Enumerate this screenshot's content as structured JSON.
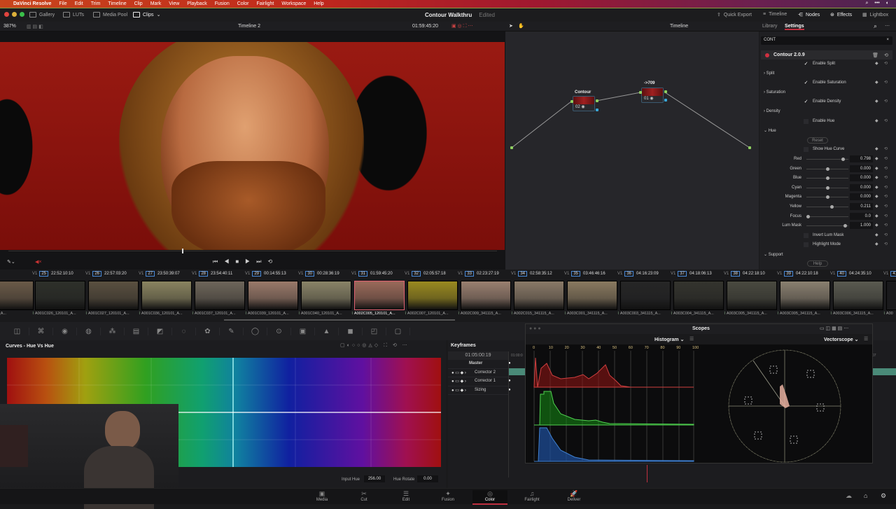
{
  "menubar": {
    "apple": "",
    "app": "DaVinci Resolve",
    "items": [
      "File",
      "Edit",
      "Trim",
      "Timeline",
      "Clip",
      "Mark",
      "View",
      "Playback",
      "Fusion",
      "Color",
      "Fairlight",
      "Workspace",
      "Help"
    ],
    "color_left": "#c8451c",
    "color_right": "#4a2450"
  },
  "titlebar": {
    "title": "Contour Walkthru",
    "status": "Edited",
    "left": [
      "Gallery",
      "LUTs",
      "Media Pool",
      "Clips"
    ],
    "right": [
      "Quick Export",
      "Timeline",
      "Nodes",
      "Effects",
      "Lightbox"
    ]
  },
  "viewerbar": {
    "zoom": "387%",
    "timeline": "Timeline 2",
    "timecode": "01:59:45:20",
    "node_mode": "Timeline",
    "tabs": [
      "Library",
      "Settings"
    ],
    "active_tab": "Settings"
  },
  "nodes": [
    {
      "label": "Contour",
      "num": "02"
    },
    {
      "label": "->709",
      "num": "01"
    }
  ],
  "settings": {
    "search": "CONT",
    "effect": "Contour 2.0.9",
    "rows": [
      {
        "type": "check",
        "label": "Enable Split",
        "checked": true
      },
      {
        "type": "section",
        "label": "Split",
        "open": false
      },
      {
        "type": "check",
        "label": "Enable Saturation",
        "checked": true
      },
      {
        "type": "section",
        "label": "Saturation",
        "open": false
      },
      {
        "type": "check",
        "label": "Enable Density",
        "checked": true
      },
      {
        "type": "section",
        "label": "Density",
        "open": false
      },
      {
        "type": "check",
        "label": "Enable Hue",
        "checked": false
      },
      {
        "type": "section",
        "label": "Hue",
        "open": true
      },
      {
        "type": "button",
        "label": "Reset"
      },
      {
        "type": "check",
        "label": "Show Hue Curve",
        "checked": false
      },
      {
        "type": "slider",
        "label": "Red",
        "value": "0.798",
        "level": 0.9
      },
      {
        "type": "slider",
        "label": "Green",
        "value": "0.000",
        "level": 0.5
      },
      {
        "type": "slider",
        "label": "Blue",
        "value": "0.000",
        "level": 0.5
      },
      {
        "type": "slider",
        "label": "Cyan",
        "value": "0.000",
        "level": 0.5
      },
      {
        "type": "slider",
        "label": "Magenta",
        "value": "0.000",
        "level": 0.5
      },
      {
        "type": "slider",
        "label": "Yellow",
        "value": "0.211",
        "level": 0.6
      },
      {
        "type": "slider",
        "label": "Focus",
        "value": "0.0",
        "level": 0.0
      },
      {
        "type": "slider",
        "label": "Lum Mask",
        "value": "1.000",
        "level": 0.95
      },
      {
        "type": "check",
        "label": "Invert Lum Mask",
        "checked": false
      },
      {
        "type": "check",
        "label": "Highlight Mode",
        "checked": false
      },
      {
        "type": "section",
        "label": "Support",
        "open": true
      },
      {
        "type": "button",
        "label": "Help"
      }
    ]
  },
  "clips": [
    {
      "num": "",
      "tc": "47:54:17",
      "name": "_120101_A...",
      "color": "#6a5a48"
    },
    {
      "num": "25",
      "tc": "22:52:10:10",
      "name": "A001C026_120101_A...",
      "color": "#2e302a"
    },
    {
      "num": "26",
      "tc": "22:57:03:20",
      "name": "A001C027_120101_A...",
      "color": "#5a5040"
    },
    {
      "num": "27",
      "tc": "23:50:39:07",
      "name": "A001C036_120101_A...",
      "color": "#8a8460"
    },
    {
      "num": "28",
      "tc": "23:54:40:11",
      "name": "A001C037_120101_A...",
      "color": "#6e665a"
    },
    {
      "num": "29",
      "tc": "00:14:55:13",
      "name": "A001C039_120101_A...",
      "color": "#9a7a6a"
    },
    {
      "num": "30",
      "tc": "00:28:36:19",
      "name": "A001C040_120101_A...",
      "color": "#8a8468"
    },
    {
      "num": "31",
      "tc": "01:59:45:20",
      "name": "A002C005_120101_A...",
      "color": "#9a6a5a",
      "selected": true
    },
    {
      "num": "32",
      "tc": "02:05:57:18",
      "name": "A002C007_120101_A...",
      "color": "#9a8a20"
    },
    {
      "num": "33",
      "tc": "02:23:27:19",
      "name": "A002C009_341115_A...",
      "color": "#9a8070"
    },
    {
      "num": "34",
      "tc": "02:58:35:12",
      "name": "A002C015_341115_A...",
      "color": "#8a7a68"
    },
    {
      "num": "35",
      "tc": "03:46:46:16",
      "name": "A003C001_341115_A...",
      "color": "#8a7a60"
    },
    {
      "num": "36",
      "tc": "04:16:23:09",
      "name": "A003C003_341115_A...",
      "color": "#262626"
    },
    {
      "num": "37",
      "tc": "04:18:06:13",
      "name": "A003C004_341115_A...",
      "color": "#34342e"
    },
    {
      "num": "38",
      "tc": "04:22:18:10",
      "name": "A003C005_341115_A...",
      "color": "#4a4a40"
    },
    {
      "num": "39",
      "tc": "04:22:10:18",
      "name": "A003C005_341115_A...",
      "color": "#8a8070"
    },
    {
      "num": "40",
      "tc": "04:24:35:10",
      "name": "A003C006_341115_A...",
      "color": "#5a5a50"
    },
    {
      "num": "41",
      "tc": "",
      "name": "A00",
      "color": "#444"
    }
  ],
  "palette_icons": [
    "camera-raw",
    "color-match",
    "color-wheels",
    "hdr-wheels",
    "rgb-mixer",
    "motion-effects",
    "curves",
    "color-warper",
    "qualifier",
    "eyedropper",
    "window",
    "tracker",
    "magic-mask",
    "blur",
    "key",
    "sizing",
    "3d"
  ],
  "curves": {
    "title": "Curves - Hue Vs Hue",
    "input_hue_label": "Input Hue",
    "input_hue": "256.00",
    "hue_rotate_label": "Hue Rotate",
    "hue_rotate": "0.00"
  },
  "keyframes": {
    "title": "Keyframes",
    "timecode": "01:05:00:19",
    "ruler": "01:00:0",
    "tracks": [
      "Master",
      "Corrector 2",
      "Corrector 1",
      "Sizing"
    ],
    "end_tc": "07"
  },
  "scopes": {
    "title": "Scopes",
    "left": "Histogram",
    "right": "Vectorscope",
    "ticks": [
      "0",
      "10",
      "20",
      "30",
      "40",
      "50",
      "60",
      "70",
      "80",
      "90",
      "100"
    ],
    "vector_targets": [
      "R",
      "Mg",
      "B",
      "Cy",
      "G",
      "Yl"
    ]
  },
  "pages": [
    {
      "label": "Media",
      "icon": "▣"
    },
    {
      "label": "Cut",
      "icon": "✂"
    },
    {
      "label": "Edit",
      "icon": "☰"
    },
    {
      "label": "Fusion",
      "icon": "✦"
    },
    {
      "label": "Color",
      "icon": "◎",
      "active": true
    },
    {
      "label": "Fairlight",
      "icon": "♫"
    },
    {
      "label": "Deliver",
      "icon": "🚀"
    }
  ]
}
